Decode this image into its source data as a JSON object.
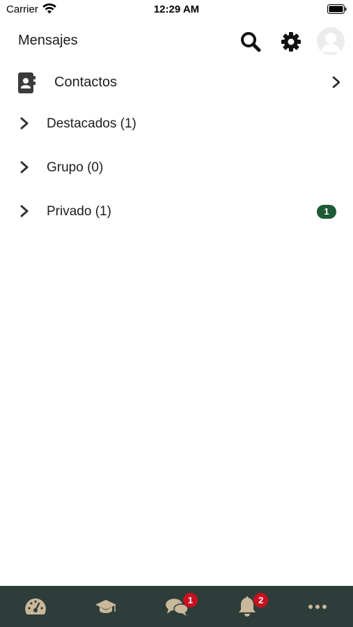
{
  "status_bar": {
    "carrier": "Carrier",
    "time": "12:29 AM"
  },
  "header": {
    "title": "Mensajes",
    "icons": [
      "search-icon",
      "gear-icon",
      "avatar"
    ]
  },
  "contacts_row": {
    "label": "Contactos",
    "icon": "address-book-icon"
  },
  "conversation_groups": [
    {
      "label": "Destacados (1)",
      "unread": null
    },
    {
      "label": "Grupo (0)",
      "unread": null
    },
    {
      "label": "Privado (1)",
      "unread": "1"
    }
  ],
  "tab_bar": {
    "tabs": [
      {
        "name": "dashboard",
        "icon": "speedometer-icon",
        "badge": null
      },
      {
        "name": "courses",
        "icon": "graduation-cap-icon",
        "badge": null
      },
      {
        "name": "messages",
        "icon": "chat-bubbles-icon",
        "badge": "1"
      },
      {
        "name": "notifications",
        "icon": "bell-icon",
        "badge": "2"
      },
      {
        "name": "more",
        "icon": "more-dots-icon",
        "badge": null
      }
    ]
  },
  "colors": {
    "tab_bar_bg": "#2d3d3a",
    "tab_icon": "#c9b899",
    "badge_red": "#c8101e",
    "unread_green": "#1d5a35",
    "text": "#1c1c1c"
  }
}
